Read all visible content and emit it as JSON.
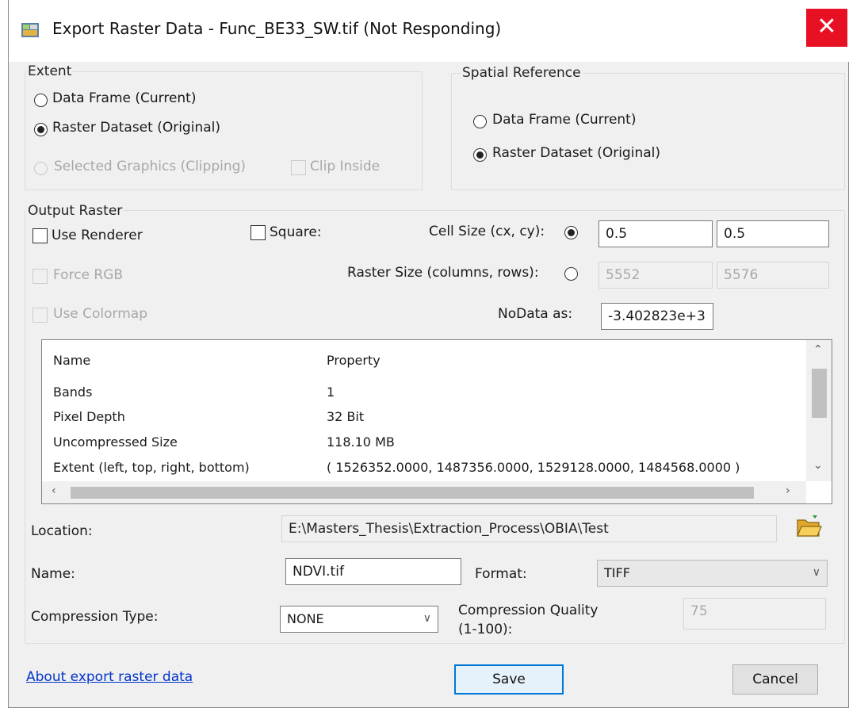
{
  "window": {
    "title": "Export Raster Data - Func_BE33_SW.tif (Not Responding)",
    "close_label": "✕"
  },
  "extent": {
    "group_label": "Extent",
    "data_frame": "Data Frame (Current)",
    "raster_dataset": "Raster Dataset (Original)",
    "selected_graphics": "Selected Graphics (Clipping)",
    "clip_inside": "Clip Inside",
    "selected": "raster_dataset"
  },
  "spatial_reference": {
    "group_label": "Spatial Reference",
    "data_frame": "Data Frame (Current)",
    "raster_dataset": "Raster Dataset (Original)",
    "selected": "raster_dataset"
  },
  "output_raster": {
    "group_label": "Output Raster",
    "use_renderer": "Use Renderer",
    "force_rgb": "Force RGB",
    "use_colormap": "Use Colormap",
    "square": "Square:",
    "cell_size_label": "Cell Size (cx, cy):",
    "cell_size_cx": "0.5",
    "cell_size_cy": "0.5",
    "raster_size_label": "Raster Size (columns, rows):",
    "raster_columns": "5552",
    "raster_rows": "5576",
    "nodata_label": "NoData as:",
    "nodata_value": "-3.402823e+3",
    "size_mode": "cell_size"
  },
  "properties": {
    "header_name": "Name",
    "header_property": "Property",
    "rows": [
      {
        "name": "Bands",
        "value": "1"
      },
      {
        "name": "Pixel Depth",
        "value": "32 Bit"
      },
      {
        "name": "Uncompressed Size",
        "value": "118.10 MB"
      },
      {
        "name": "Extent (left, top, right, bottom)",
        "value": "( 1526352.0000, 1487356.0000, 1529128.0000, 1484568.0000 )"
      }
    ]
  },
  "location": {
    "label": "Location:",
    "value": "E:\\Masters_Thesis\\Extraction_Process\\OBIA\\Test"
  },
  "name": {
    "label": "Name:",
    "value": "NDVI.tif"
  },
  "format": {
    "label": "Format:",
    "value": "TIFF"
  },
  "compression": {
    "type_label": "Compression Type:",
    "type_value": "NONE",
    "quality_label_1": "Compression Quality",
    "quality_label_2": "(1-100):",
    "quality_value": "75"
  },
  "footer": {
    "about_link": "About export raster data",
    "save": "Save",
    "cancel": "Cancel"
  },
  "icons": {
    "title": "raster-app-icon",
    "close": "close-icon",
    "folder": "open-folder-icon"
  },
  "colors": {
    "close_red": "#e81123",
    "accent_blue": "#0078d7",
    "link_blue": "#0033cc"
  }
}
